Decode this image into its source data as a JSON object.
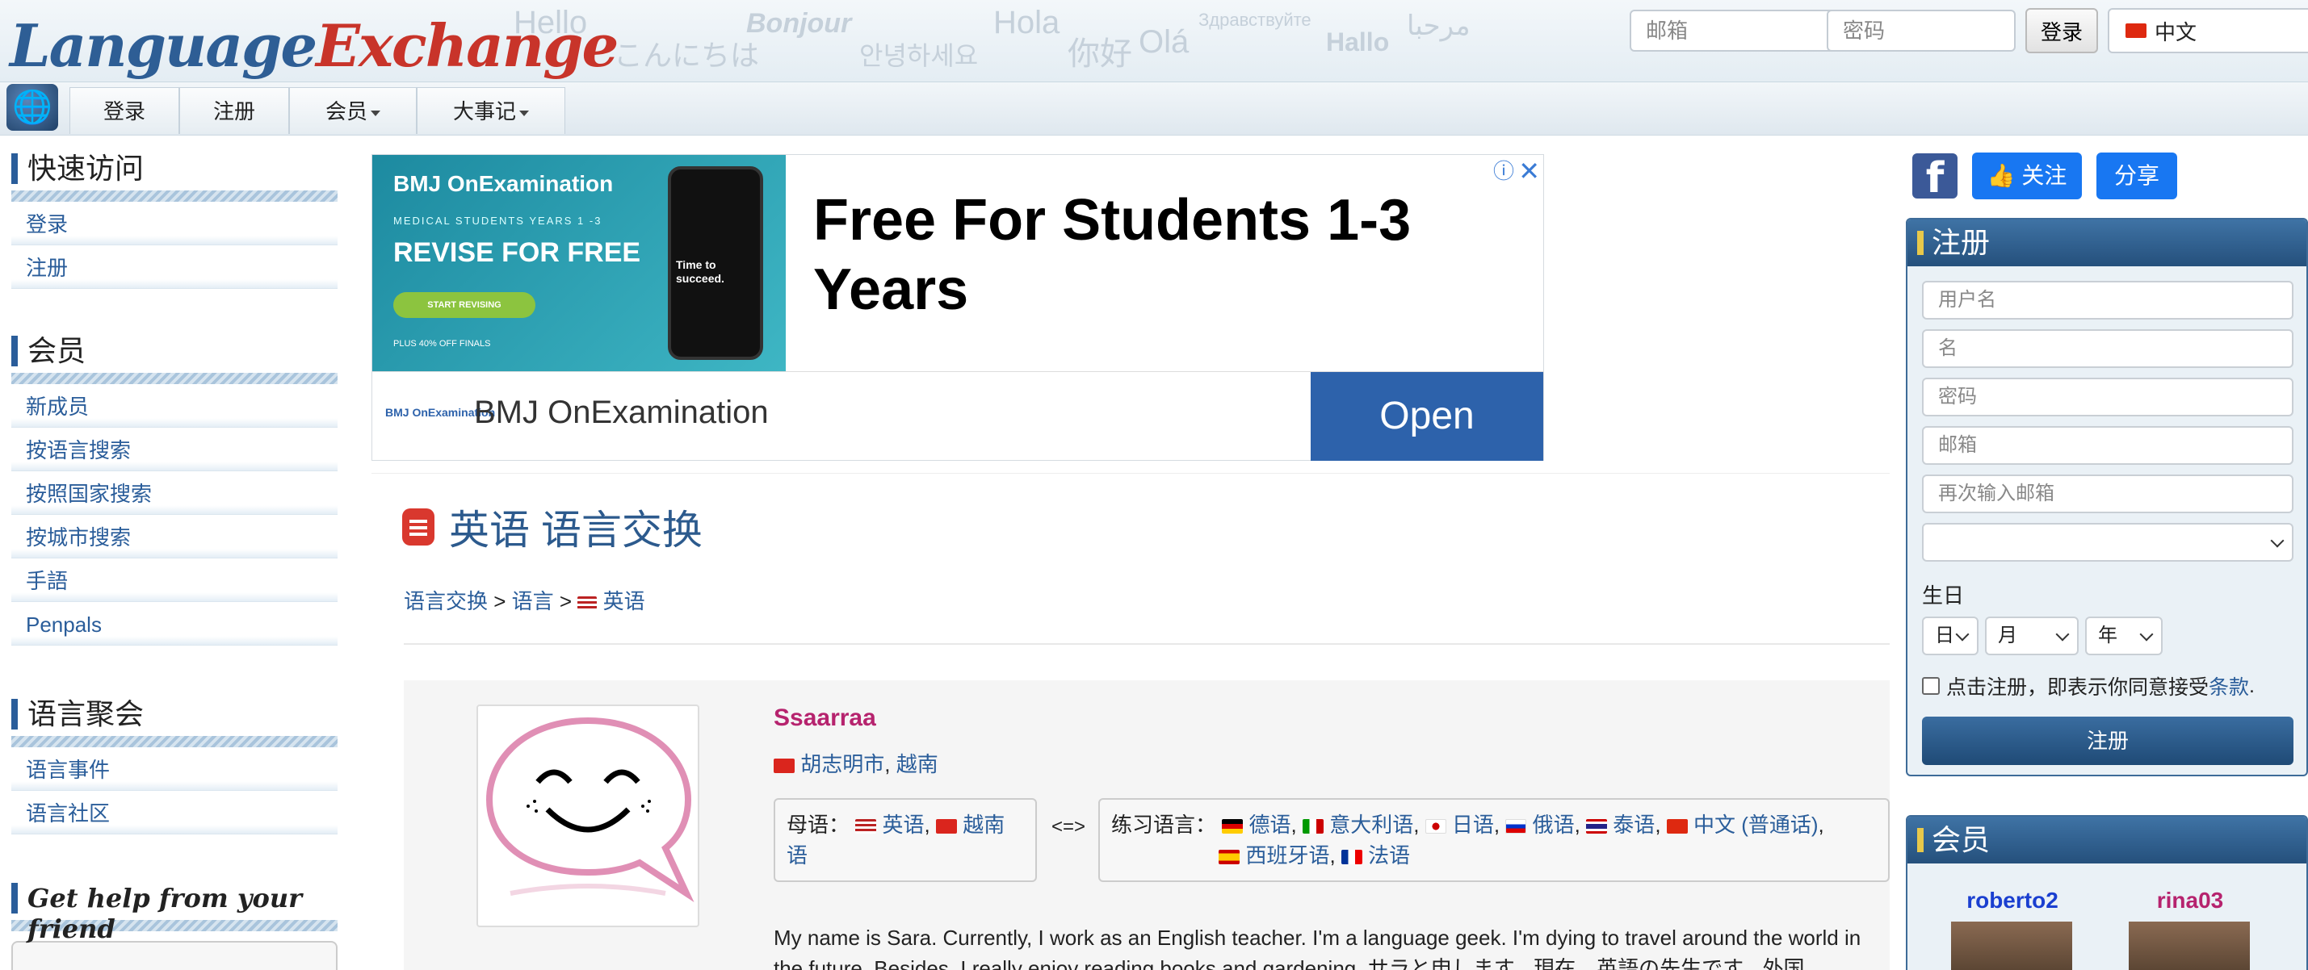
{
  "header": {
    "logo_part1": "Language",
    "logo_part2": "Exchange",
    "hello_words": [
      "Hello",
      "こんにちは",
      "Bonjour",
      "안녕하세요",
      "Hola",
      "你好",
      "Olá",
      "Здравствуйте",
      "Hallo",
      "مرحبا"
    ],
    "email_placeholder": "邮箱",
    "password_placeholder": "密码",
    "login_button": "登录",
    "language_selected": "中文"
  },
  "nav": {
    "globe_icon": "globe-icon",
    "items": [
      "登录",
      "注册",
      "会员",
      "大事记"
    ]
  },
  "sidebar": {
    "sections": [
      {
        "title": "快速访问",
        "items": [
          "登录",
          "注册"
        ]
      },
      {
        "title": "会员",
        "items": [
          "新成员",
          "按语言搜索",
          "按照国家搜索",
          "按城市搜索",
          "手語",
          "Penpals"
        ]
      },
      {
        "title": "语言聚会",
        "items": [
          "语言事件",
          "语言社区"
        ]
      },
      {
        "title": "Get help from your friend",
        "items": []
      }
    ]
  },
  "ad": {
    "brand_small": "BMJ OnExamination",
    "kicker": "MEDICAL STUDENTS YEARS 1 -3",
    "headline_small": "REVISE FOR FREE",
    "cta_small": "START REVISING",
    "footnote": "PLUS 40% OFF FINALS",
    "phone_text": "Time to succeed.",
    "title": "Free For Students 1-3 Years",
    "advertiser": "BMJ OnExamination",
    "open_label": "Open"
  },
  "main": {
    "page_title": "英语 语言交换",
    "breadcrumb": {
      "root": "语言交换",
      "sep1": ">",
      "languages": "语言",
      "sep2": ">",
      "current": "英语"
    },
    "profile": {
      "name": "Ssaarraa",
      "city": "胡志明市",
      "country": "越南",
      "native_label": "母语：",
      "native_langs": [
        "英语",
        "越南语"
      ],
      "exchange_arrow": "<=>",
      "practice_label": "练习语言：",
      "practice_langs": [
        "德语",
        "意大利语",
        "日语",
        "俄语",
        "泰语",
        "中文 (普通话)",
        "西班牙语",
        "法语"
      ],
      "bio": "My name is Sara. Currently, I work as an English teacher. I'm a language geek. I'm dying to travel around the world in the future. Besides, I really enjoy reading books and gardening. サラと申します。現在、英語の先生です。外国"
    }
  },
  "right": {
    "follow_label": "关注",
    "share_label": "分享",
    "register": {
      "title": "注册",
      "username_placeholder": "用户名",
      "firstname_placeholder": "名",
      "password_placeholder": "密码",
      "email_placeholder": "邮箱",
      "email2_placeholder": "再次输入邮箱",
      "birthday_label": "生日",
      "day_label": "日",
      "month_label": "月",
      "year_label": "年",
      "terms_text": "点击注册，即表示你同意接受",
      "terms_link": "条款",
      "terms_end": ".",
      "submit_label": "注册"
    },
    "members": {
      "title": "会员",
      "names": [
        "roberto2",
        "rina03"
      ]
    }
  },
  "colors": {
    "brand_blue": "#2e5e95",
    "brand_red": "#c8342a",
    "link": "#2a5d9a",
    "profile_name": "#b6236e",
    "facebook": "#1877f2"
  }
}
